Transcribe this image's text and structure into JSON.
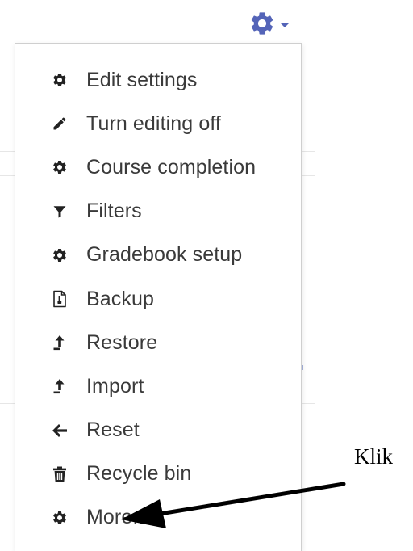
{
  "settings_menu": {
    "trigger_icon": "gear-icon",
    "accent_color": "#5464b8",
    "items": [
      {
        "label": "Edit settings",
        "icon": "gear-icon"
      },
      {
        "label": "Turn editing off",
        "icon": "pencil-icon"
      },
      {
        "label": "Course completion",
        "icon": "gear-icon"
      },
      {
        "label": "Filters",
        "icon": "filter-icon"
      },
      {
        "label": "Gradebook setup",
        "icon": "gear-icon"
      },
      {
        "label": "Backup",
        "icon": "file-icon"
      },
      {
        "label": "Restore",
        "icon": "upload-icon"
      },
      {
        "label": "Import",
        "icon": "upload-icon"
      },
      {
        "label": "Reset",
        "icon": "arrow-left-icon"
      },
      {
        "label": "Recycle bin",
        "icon": "trash-icon"
      },
      {
        "label": "More...",
        "icon": "gear-icon"
      }
    ]
  },
  "annotation": {
    "label": "Klik",
    "color": "#000000"
  }
}
